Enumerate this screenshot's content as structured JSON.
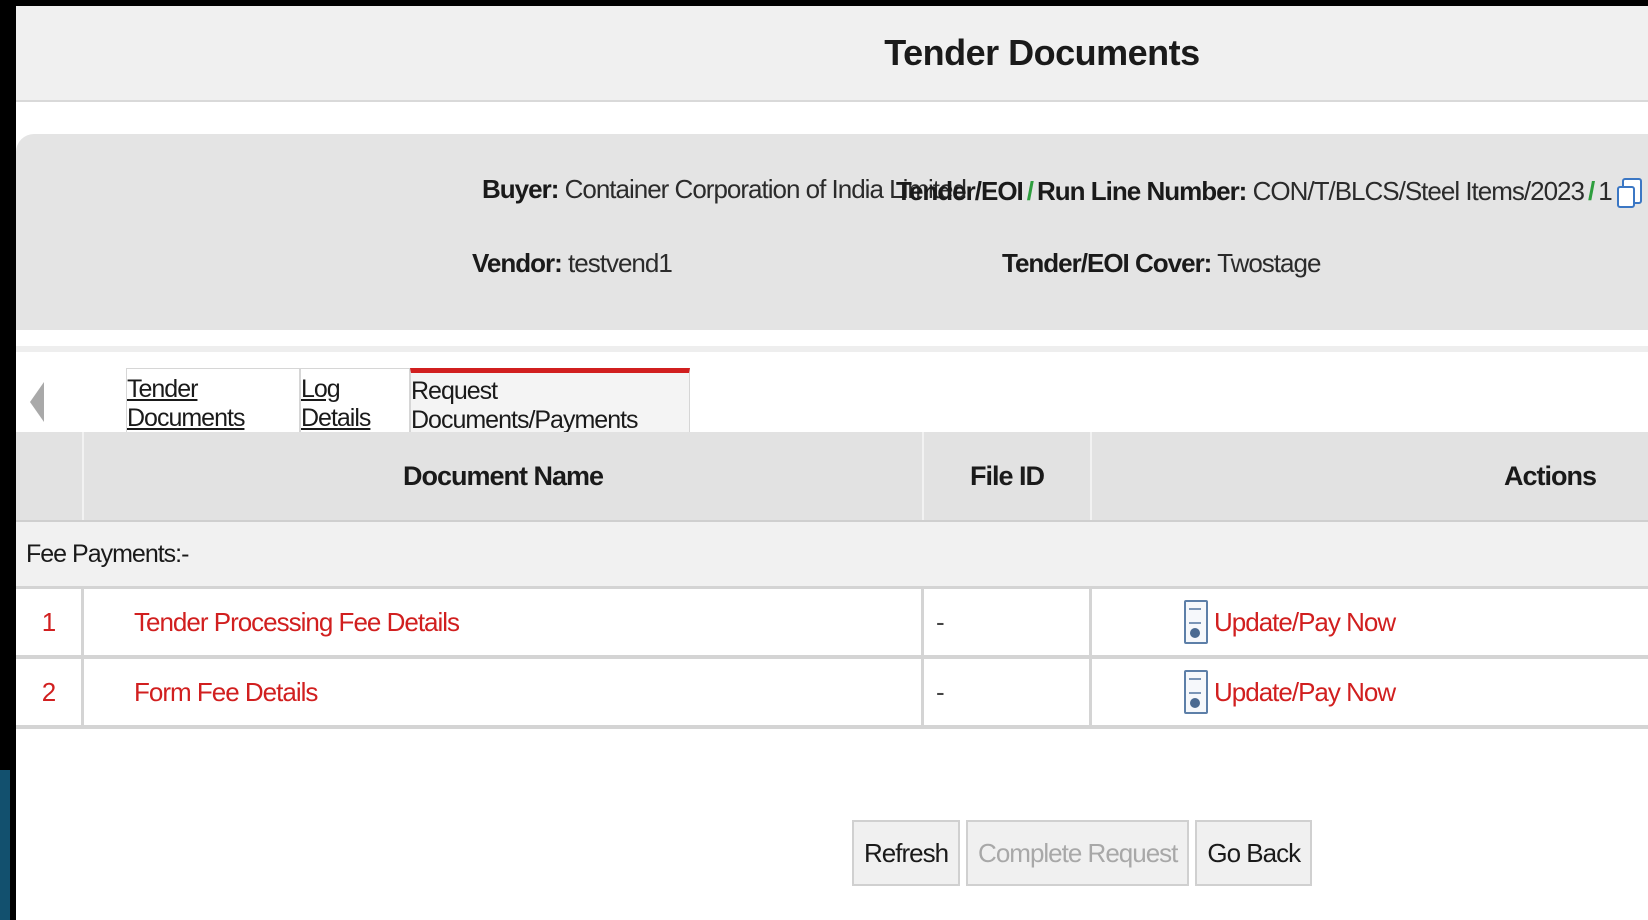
{
  "page": {
    "title": "Tender Documents"
  },
  "info": {
    "buyer_label": "Buyer:",
    "buyer_value": "Container Corporation of India Limited",
    "tender_label_a": "Tender/EOI",
    "tender_label_b": "Run Line Number:",
    "tender_value_a": "CON/T/BLCS/Steel Items/2023",
    "tender_value_b": "1",
    "vendor_label": "Vendor:",
    "vendor_value": "testvend1",
    "cover_label": "Tender/EOI Cover:",
    "cover_value": "Twostage"
  },
  "tabs": [
    {
      "label": "Tender Documents",
      "active": false
    },
    {
      "label": "Log Details",
      "active": false
    },
    {
      "label": "Request Documents/Payments",
      "active": true
    }
  ],
  "table": {
    "headers": {
      "name": "Document Name",
      "file_id": "File ID",
      "actions": "Actions"
    },
    "section_label": "Fee Payments:-",
    "rows": [
      {
        "num": "1",
        "name": "Tender Processing Fee Details",
        "file_id": "-",
        "action": "Update/Pay Now"
      },
      {
        "num": "2",
        "name": "Form Fee Details",
        "file_id": "-",
        "action": "Update/Pay Now"
      }
    ]
  },
  "buttons": {
    "refresh": "Refresh",
    "complete": "Complete Request",
    "go_back": "Go Back"
  },
  "colors": {
    "accent_red": "#d11f1f",
    "slash_green": "#2e9e3e",
    "header_gray": "#e2e2e2"
  }
}
